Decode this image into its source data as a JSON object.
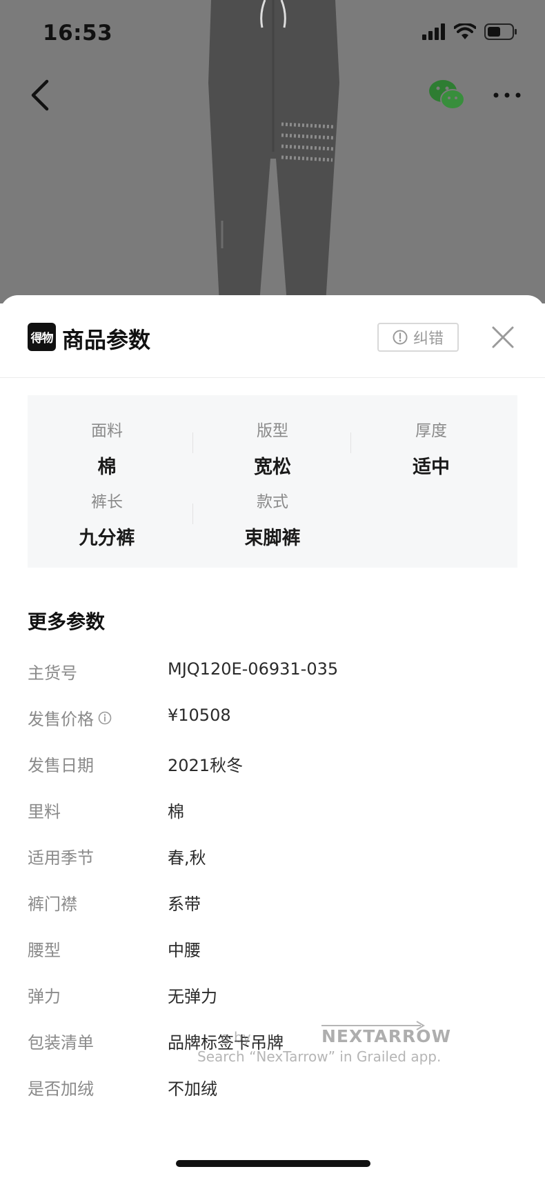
{
  "status_bar": {
    "time": "16:53"
  },
  "nav": {
    "back_icon": "chevron-left-icon",
    "share_icon": "wechat-icon",
    "more_icon": "more-dots-icon"
  },
  "sheet": {
    "logo_text": "得物",
    "title": "商品参数",
    "report_label": "纠错",
    "close_icon": "close-icon"
  },
  "key_attributes": [
    {
      "label": "面料",
      "value": "棉"
    },
    {
      "label": "版型",
      "value": "宽松"
    },
    {
      "label": "厚度",
      "value": "适中"
    },
    {
      "label": "裤长",
      "value": "九分裤"
    },
    {
      "label": "款式",
      "value": "束脚裤"
    }
  ],
  "more_params": {
    "title": "更多参数",
    "rows": [
      {
        "label": "主货号",
        "value": "MJQ120E-06931-035"
      },
      {
        "label": "发售价格",
        "value": "¥10508",
        "has_info_icon": true
      },
      {
        "label": "发售日期",
        "value": "2021秋冬"
      },
      {
        "label": "里料",
        "value": "棉"
      },
      {
        "label": "适用季节",
        "value": "春,秋"
      },
      {
        "label": "裤门襟",
        "value": "系带"
      },
      {
        "label": "腰型",
        "value": "中腰"
      },
      {
        "label": "弹力",
        "value": "无弹力"
      },
      {
        "label": "包装清单",
        "value": "品牌标签卡吊牌"
      },
      {
        "label": "是否加绒",
        "value": "不加绒"
      }
    ]
  },
  "watermark": {
    "line1": "g by",
    "brand": "NEXTARROW",
    "line2": "Search “NexTarrow” in Grailed app."
  },
  "colors": {
    "background_overlay": "#7b7b7b",
    "wechat_green": "#2e7d32",
    "label_gray": "#8a8a8a",
    "grid_bg": "#f6f7f8"
  }
}
